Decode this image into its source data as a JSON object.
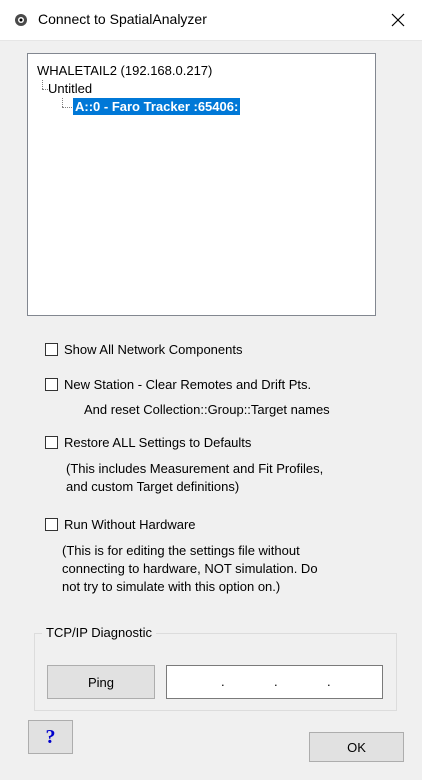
{
  "window": {
    "title": "Connect to SpatialAnalyzer",
    "app_icon": "spatialanalyzer-icon",
    "close_icon": "close-icon"
  },
  "tree": {
    "root": "WHALETAIL2 (192.168.0.217)",
    "child": "Untitled",
    "selected_item": "A::0 - Faro Tracker :65406:"
  },
  "options": {
    "show_all": {
      "label": "Show All Network Components",
      "checked": false
    },
    "new_station": {
      "label": "New Station - Clear Remotes and Drift Pts.",
      "note": "And reset Collection::Group::Target names",
      "checked": false
    },
    "restore_defaults": {
      "label": "Restore ALL Settings to Defaults",
      "note_line1": "(This includes Measurement and Fit Profiles,",
      "note_line2": "and custom Target definitions)",
      "checked": false
    },
    "run_without_hw": {
      "label": "Run Without Hardware",
      "note_line1": "(This is for editing the settings file without",
      "note_line2": "connecting to hardware, NOT simulation.  Do",
      "note_line3": "not try to simulate with this option on.)",
      "checked": false
    }
  },
  "diagnostic": {
    "group_label": "TCP/IP Diagnostic",
    "ping_label": "Ping",
    "ip_separator": "."
  },
  "footer": {
    "help_label": "?",
    "ok_label": "OK"
  }
}
